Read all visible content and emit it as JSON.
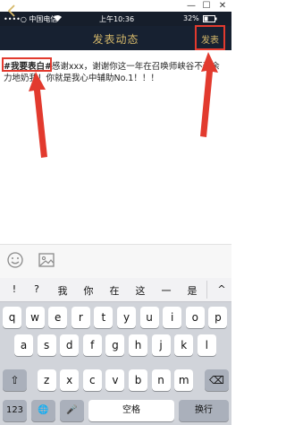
{
  "window": {
    "minimize": "—",
    "maximize": "☐",
    "close": "✕"
  },
  "status": {
    "carrier": "••••○ 中国电信",
    "time": "上午10:36",
    "battery": "32%"
  },
  "nav": {
    "back_symbol": "<",
    "title": "发表动态",
    "post_label": "发表"
  },
  "post": {
    "hashtag": "#我要表白#",
    "text": "感谢xxx，谢谢你这一年在召唤师峡谷不遗余力地奶我！你就是我心中辅助No.1！！！"
  },
  "toolbar": {
    "emoji_icon": "emoji-icon",
    "image_icon": "image-icon"
  },
  "keyboard": {
    "candidates": [
      "!",
      "?",
      "我",
      "你",
      "在",
      "这",
      "一",
      "是"
    ],
    "collapse_symbol": "^",
    "row1": [
      "q",
      "w",
      "e",
      "r",
      "t",
      "y",
      "u",
      "i",
      "o",
      "p"
    ],
    "row2": [
      "a",
      "s",
      "d",
      "f",
      "g",
      "h",
      "j",
      "k",
      "l"
    ],
    "row3": [
      "z",
      "x",
      "c",
      "v",
      "b",
      "n",
      "m"
    ],
    "shift_symbol": "⇧",
    "delete_symbol": "⌫",
    "numbers_label": "123",
    "globe_symbol": "🌐",
    "mic_symbol": "🎤",
    "space_label": "空格",
    "return_label": "换行"
  },
  "annotation_color": "#e23a2e",
  "accent_color": "#d6b96a"
}
